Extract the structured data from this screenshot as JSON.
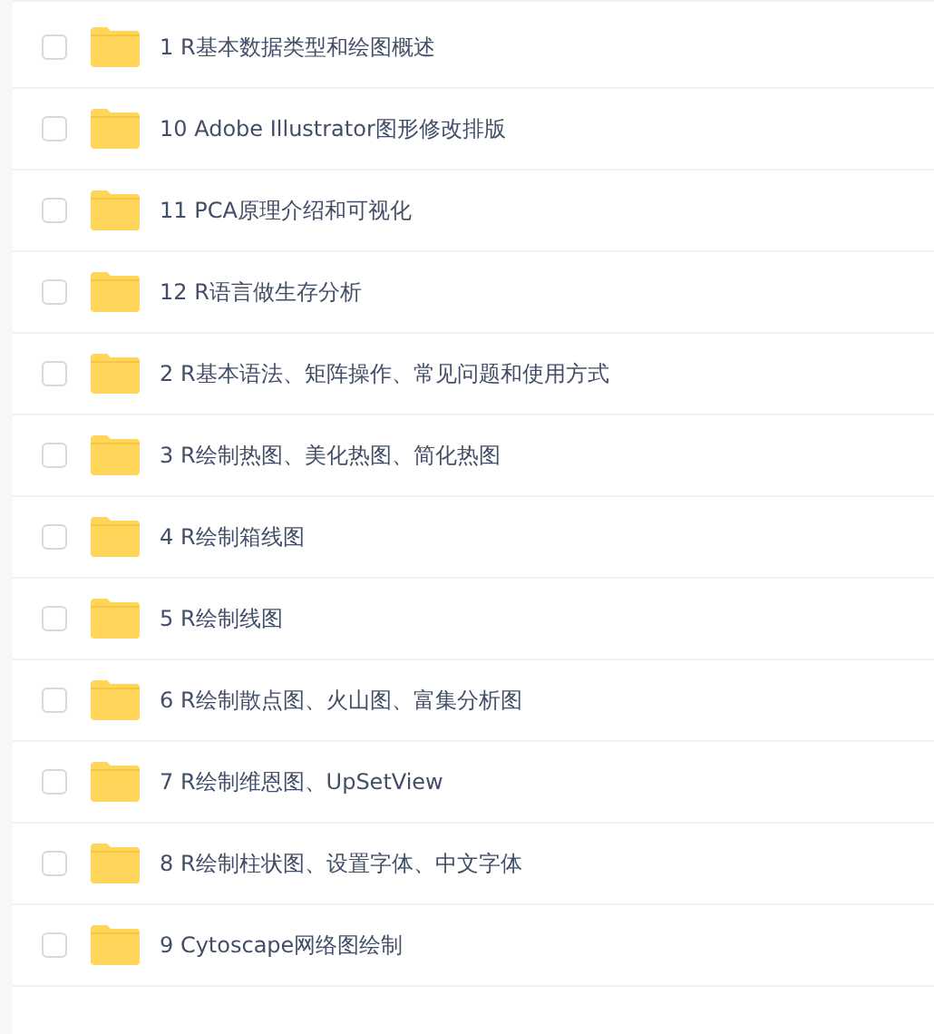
{
  "files": [
    {
      "name": "1 R基本数据类型和绘图概述",
      "checked": false
    },
    {
      "name": "10 Adobe Illustrator图形修改排版",
      "checked": false
    },
    {
      "name": "11 PCA原理介绍和可视化",
      "checked": false
    },
    {
      "name": "12 R语言做生存分析",
      "checked": false
    },
    {
      "name": "2 R基本语法、矩阵操作、常见问题和使用方式",
      "checked": false
    },
    {
      "name": "3 R绘制热图、美化热图、简化热图",
      "checked": false
    },
    {
      "name": "4 R绘制箱线图",
      "checked": false
    },
    {
      "name": "5 R绘制线图",
      "checked": false
    },
    {
      "name": "6 R绘制散点图、火山图、富集分析图",
      "checked": false
    },
    {
      "name": "7 R绘制维恩图、UpSetView",
      "checked": false
    },
    {
      "name": "8 R绘制柱状图、设置字体、中文字体",
      "checked": false
    },
    {
      "name": "9 Cytoscape网络图绘制",
      "checked": false
    }
  ]
}
